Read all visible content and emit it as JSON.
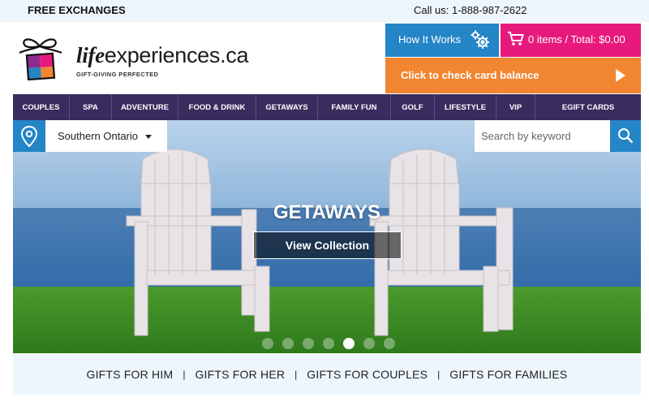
{
  "topbar": {
    "free_exchanges": "FREE EXCHANGES",
    "call_us": "Call us: 1-888-987-2622"
  },
  "logo": {
    "word_life": "life",
    "word_rest": "experiences.ca",
    "tagline": "GIFT-GIVING PERFECTED"
  },
  "header": {
    "how_it_works": "How It Works",
    "cart_summary": "0 items / Total: $0.00",
    "check_balance": "Click to check card balance"
  },
  "nav": {
    "items": [
      "COUPLES",
      "SPA",
      "ADVENTURE",
      "FOOD & DRINK",
      "GETAWAYS",
      "FAMILY FUN",
      "GOLF",
      "LIFESTYLE",
      "VIP",
      "EGIFT CARDS"
    ]
  },
  "location": {
    "selected": "Southern Ontario"
  },
  "search": {
    "placeholder": "Search by keyword"
  },
  "hero": {
    "title": "GETAWAYS",
    "button": "View Collection",
    "slide_count": 7,
    "active_slide": 5
  },
  "bottom": {
    "links": [
      "GIFTS FOR HIM",
      "GIFTS FOR HER",
      "GIFTS FOR COUPLES",
      "GIFTS FOR FAMILIES"
    ],
    "separator": "|"
  },
  "colors": {
    "blue": "#2485c7",
    "pink": "#e8197d",
    "orange": "#f18530",
    "nav_purple": "#3a2c5e",
    "light_bg": "#eef6fd"
  }
}
